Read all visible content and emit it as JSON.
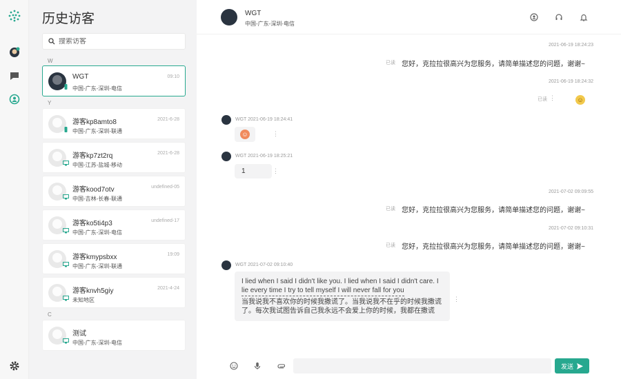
{
  "app": {
    "title": "历史访客",
    "accent": "#27a88f"
  },
  "search": {
    "placeholder": "搜索访客"
  },
  "groups": {
    "w": "W",
    "y": "Y",
    "c": "C"
  },
  "visitors": [
    {
      "name": "WGT",
      "location": "中国-广东-深圳-电信",
      "time": "09:10",
      "device": "phone"
    },
    {
      "name": "游客kp8amto8",
      "location": "中国-广东-深圳-联通",
      "time": "2021-6-28",
      "device": "phone"
    },
    {
      "name": "游客kp7zt2rq",
      "location": "中国-江苏-盐城-移动",
      "time": "2021-6-28",
      "device": "desktop"
    },
    {
      "name": "游客kood7otv",
      "location": "中国-吉林-长春-联通",
      "time": "undefined-05",
      "device": "desktop"
    },
    {
      "name": "游客ko5ti4p3",
      "location": "中国-广东-深圳-电信",
      "time": "undefined-17",
      "device": "desktop"
    },
    {
      "name": "游客kmypsbxx",
      "location": "中国-广东-深圳-联通",
      "time": "19:09",
      "device": "desktop"
    },
    {
      "name": "游客knvh5giy",
      "location": "未知地区",
      "time": "2021-4-24",
      "device": "desktop"
    },
    {
      "name": "测试",
      "location": "中国-广东-深圳-电信",
      "time": "",
      "device": "desktop"
    }
  ],
  "chat": {
    "name": "WGT",
    "location": "中国-广东-深圳-电信",
    "messages": {
      "m1_time": "2021-06-19 18:24:23",
      "m1_read": "已读",
      "m1_text": "您好，克拉拉很高兴为您服务，请简单描述您的问题，谢谢~",
      "m2_time": "2021-06-19 18:24:32",
      "m2_read": "已读",
      "m3_meta": "WGT 2021-06-19 18:24:41",
      "m4_meta": "WGT 2021-06-19 18:25:21",
      "m4_text": "1",
      "m5_time": "2021-07-02 09:09:55",
      "m5_read": "已读",
      "m5_text": "您好，克拉拉很高兴为您服务，请简单描述您的问题，谢谢~",
      "m6_time": "2021-07-02 09:10:31",
      "m6_read": "已读",
      "m6_text": "您好，克拉拉很高兴为您服务，请简单描述您的问题，谢谢~",
      "m7_meta": "WGT 2021-07-02 09:10:40",
      "m7_en1": "I lied when I said I didn't like you. I lied when I said I didn't care. I",
      "m7_en2": "lie every time I try to tell myself I will never fall for you",
      "m7_zh": "当我说我不喜欢你的时候我撒谎了。当我说我不在乎的时候我撒谎了。每次我试图告诉自己我永远不会爱上你的时候，我都在撒谎"
    }
  },
  "composer": {
    "send_label": "发送"
  }
}
